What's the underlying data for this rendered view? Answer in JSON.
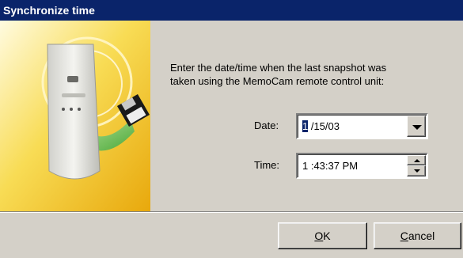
{
  "window": {
    "title": "Synchronize time"
  },
  "instructions": {
    "line1": "Enter the date/time when the last snapshot was",
    "line2": "taken using the MemoCam remote control unit:"
  },
  "date": {
    "label": "Date:",
    "value_selected": "1",
    "value_rest": " /15/03"
  },
  "time": {
    "label": "Time:",
    "value": "1 :43:37 PM"
  },
  "buttons": {
    "ok_mnemonic": "O",
    "ok_rest": "K",
    "cancel_mnemonic": "C",
    "cancel_rest": "ancel"
  },
  "icons": {
    "banner": "camera-with-floppy-disk-illustration",
    "dropdown": "chevron-down-icon",
    "spin_up": "spin-up-icon",
    "spin_down": "spin-down-icon"
  },
  "colors": {
    "titlebar": "#0a246a",
    "selection": "#0a246a",
    "dialog_face": "#d4d0c8",
    "banner_yellow": "#f2c61f"
  }
}
